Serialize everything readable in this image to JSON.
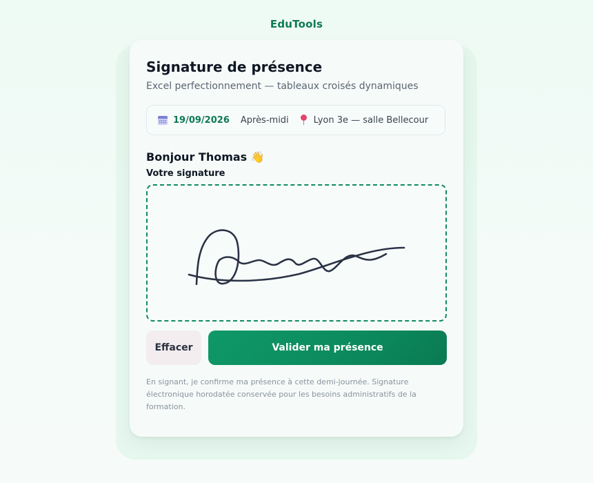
{
  "brand": "EduTools",
  "card": {
    "title": "Signature de présence",
    "subtitle": "Excel perfectionnement — tableaux croisés dynamiques"
  },
  "session": {
    "date": "19/09/2026",
    "period": "Après-midi",
    "location": "Lyon 3e — salle Bellecour",
    "date_icon": "calendar-icon",
    "location_icon": "pin-icon"
  },
  "greeting": {
    "text": "Bonjour Thomas",
    "emoji": "👋"
  },
  "signature": {
    "label": "Votre signature"
  },
  "actions": {
    "clear_label": "Effacer",
    "submit_label": "Valider ma présence"
  },
  "legal": "En signant, je confirme ma présence à cette demi-journée. Signature électronique horodatée conservée pour les besoins administratifs de la formation.",
  "colors": {
    "accent": "#0c7a52",
    "pad_border": "#118a5e",
    "ink": "#2b3245"
  }
}
